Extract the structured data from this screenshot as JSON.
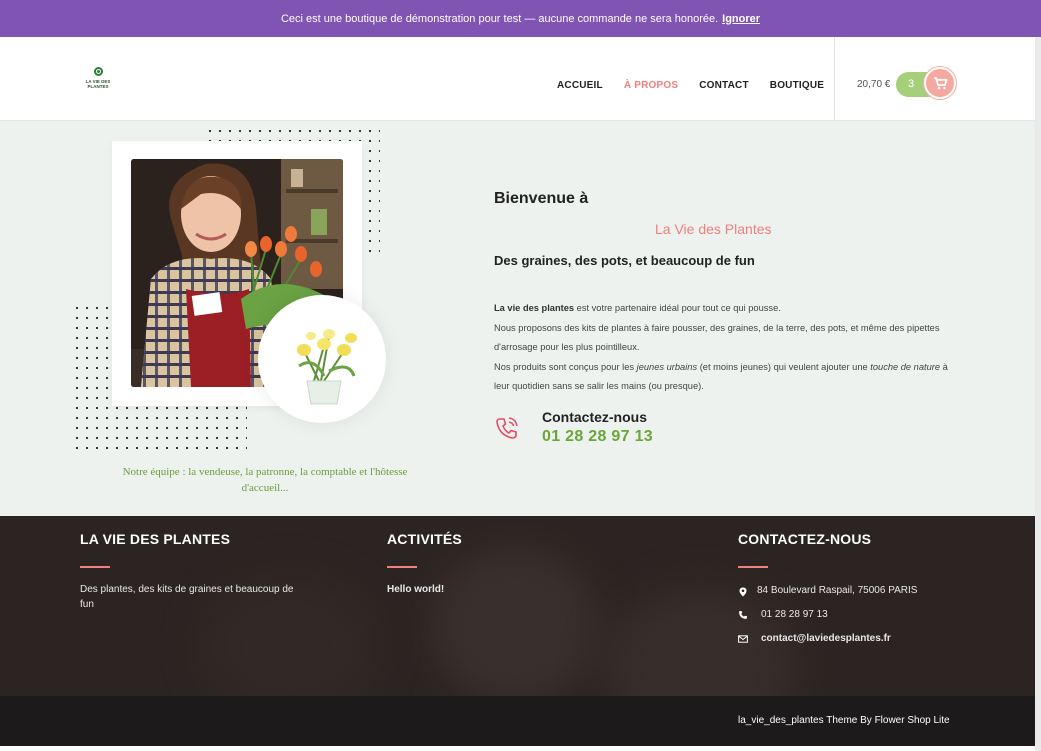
{
  "notice": {
    "text": "Ceci est une boutique de démonstration pour test — aucune commande ne sera honorée.",
    "dismiss": "Ignorer"
  },
  "logo": {
    "text": "LA VIE DES PLANTES"
  },
  "nav": {
    "items": [
      {
        "label": "ACCUEIL"
      },
      {
        "label": "À PROPOS",
        "active": true
      },
      {
        "label": "CONTACT"
      },
      {
        "label": "BOUTIQUE"
      }
    ]
  },
  "cart": {
    "total": "20,70 €",
    "count": "3",
    "icon": "cart-icon"
  },
  "hero": {
    "caption": "Notre équipe : la vendeuse, la patronne, la comptable et l'hôtesse d'accueil...",
    "welcome": "Bienvenue à",
    "brand": "La Vie des Plantes",
    "tagline": "Des graines, des pots, et beaucoup de fun",
    "desc": {
      "p1_bold": "La vie des plantes",
      "p1_rest": " est votre partenaire idéal pour tout ce qui pousse.",
      "p2": "Nous proposons des kits de plantes à faire pousser, des graines, de la terre, des pots, et même des pipettes d'arrosage pour les plus pointilleux.",
      "p3_a": "Nos produits sont conçus pour les ",
      "p3_em1": "jeunes urbains",
      "p3_b": " (et moins jeunes) qui veulent ajouter une ",
      "p3_em2": "touche de nature",
      "p3_c": " à leur quotidien sans se salir les mains (ou presque)."
    },
    "contact_title": "Contactez-nous",
    "contact_phone": "01 28 28 97 13"
  },
  "footer": {
    "col1": {
      "title": "LA VIE DES PLANTES",
      "text": "Des plantes, des kits de graines et beaucoup de fun"
    },
    "col2": {
      "title": "ACTIVITÉS",
      "link": "Hello world!"
    },
    "col3": {
      "title": "CONTACTEZ-NOUS",
      "address": "84 Boulevard Raspail, 75006 PARIS",
      "phone": "01 28 28 97 13",
      "email": "contact@laviedesplantes.fr"
    },
    "credit": "la_vie_des_plantes Theme By Flower Shop Lite"
  },
  "colors": {
    "purple": "#7f54b3",
    "pink": "#f07e7e",
    "green": "#6aa63a",
    "cartGreen": "#a5cf79",
    "cartPink": "#f4a8a0"
  }
}
